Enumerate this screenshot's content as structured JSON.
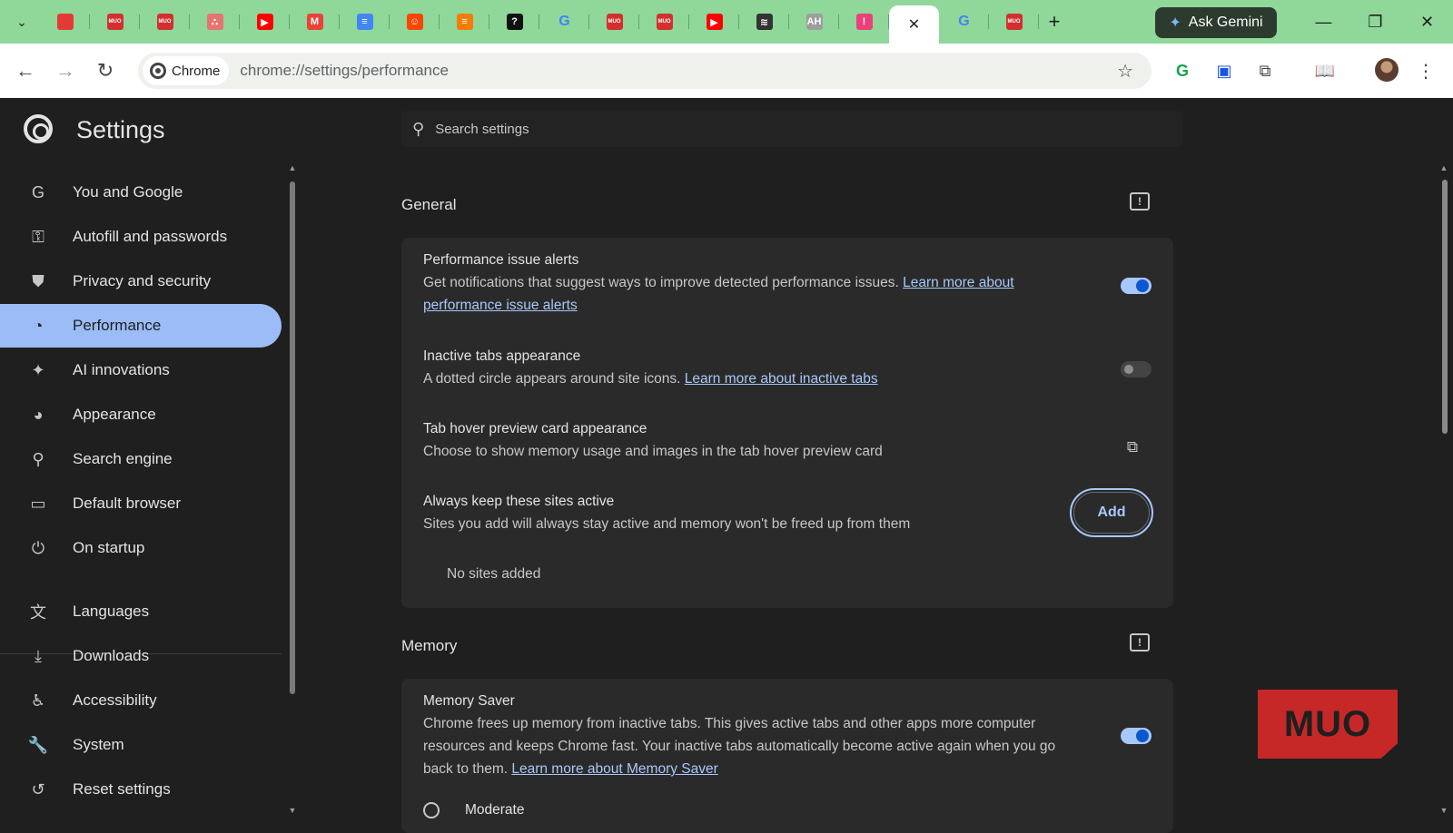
{
  "colors": {
    "tabstrip_bg": "#8fd89a",
    "page_bg": "#1f1f1f",
    "card_bg": "#2a2a2a",
    "active_nav_bg": "#9bbcf7",
    "link": "#a8c7fa",
    "toggle_on": "#0b57d0",
    "watermark": "#c62828"
  },
  "tabs": [
    {
      "icon": "red-circle-favicon",
      "color": "#e53935",
      "glyph": ""
    },
    {
      "icon": "red-badge-favicon",
      "color": "#d32f2f",
      "glyph": "MUO"
    },
    {
      "icon": "red-badge-favicon",
      "color": "#d32f2f",
      "glyph": "MUO"
    },
    {
      "icon": "dots-favicon",
      "color": "#e57373",
      "glyph": "∴"
    },
    {
      "icon": "youtube-favicon",
      "color": "#ff0000",
      "glyph": "▶"
    },
    {
      "icon": "gmail-favicon",
      "color": "#ea4335",
      "glyph": "M"
    },
    {
      "icon": "docs-favicon",
      "color": "#4285f4",
      "glyph": "≡"
    },
    {
      "icon": "reddit-favicon",
      "color": "#ff4500",
      "glyph": "☺"
    },
    {
      "icon": "orange-favicon",
      "color": "#f57c00",
      "glyph": "≡"
    },
    {
      "icon": "question-favicon",
      "color": "#111111",
      "glyph": "?"
    },
    {
      "icon": "google-favicon",
      "color": "#ffffff",
      "glyph": "G"
    },
    {
      "icon": "red-badge-favicon",
      "color": "#d32f2f",
      "glyph": "MUO"
    },
    {
      "icon": "red-badge-favicon",
      "color": "#d32f2f",
      "glyph": "MUO"
    },
    {
      "icon": "youtube-favicon",
      "color": "#ff0000",
      "glyph": "▶"
    },
    {
      "icon": "spiral-favicon",
      "color": "#333333",
      "glyph": "≋"
    },
    {
      "icon": "ah-favicon",
      "color": "#9e9e9e",
      "glyph": "AH"
    },
    {
      "icon": "pink-favicon",
      "color": "#ec407a",
      "glyph": "!"
    },
    {
      "icon": "close-icon",
      "color": "#ffffff",
      "glyph": "✕",
      "active": true
    },
    {
      "icon": "google-favicon",
      "color": "#ffffff",
      "glyph": "G"
    },
    {
      "icon": "red-badge-favicon",
      "color": "#d32f2f",
      "glyph": "MUO"
    }
  ],
  "ask_gemini_label": "Ask Gemini",
  "omnibox": {
    "chip_label": "Chrome",
    "url": "chrome://settings/performance"
  },
  "settings": {
    "title": "Settings",
    "search_placeholder": "Search settings"
  },
  "sidebar": {
    "items": [
      {
        "label": "You and Google",
        "icon": "google-g-icon",
        "glyph": "G"
      },
      {
        "label": "Autofill and passwords",
        "icon": "key-icon",
        "glyph": "⚿"
      },
      {
        "label": "Privacy and security",
        "icon": "shield-icon",
        "glyph": "⛊"
      },
      {
        "label": "Performance",
        "icon": "speedometer-icon",
        "glyph": "◔",
        "active": true
      },
      {
        "label": "AI innovations",
        "icon": "sparkle-icon",
        "glyph": "✦"
      },
      {
        "label": "Appearance",
        "icon": "palette-icon",
        "glyph": "◕"
      },
      {
        "label": "Search engine",
        "icon": "search-icon",
        "glyph": "⚲"
      },
      {
        "label": "Default browser",
        "icon": "browser-window-icon",
        "glyph": "▭"
      },
      {
        "label": "On startup",
        "icon": "power-icon",
        "glyph": "⏻"
      },
      {
        "label": "Languages",
        "icon": "translate-icon",
        "glyph": "文"
      },
      {
        "label": "Downloads",
        "icon": "download-icon",
        "glyph": "⤓"
      },
      {
        "label": "Accessibility",
        "icon": "accessibility-icon",
        "glyph": "♿"
      },
      {
        "label": "System",
        "icon": "wrench-icon",
        "glyph": "🔧"
      },
      {
        "label": "Reset settings",
        "icon": "reset-icon",
        "glyph": "↺"
      }
    ]
  },
  "general": {
    "title": "General",
    "performance_alerts": {
      "title": "Performance issue alerts",
      "desc": "Get notifications that suggest ways to improve detected performance issues. ",
      "link": "Learn more about performance issue alerts",
      "enabled": true
    },
    "inactive_tabs": {
      "title": "Inactive tabs appearance",
      "desc": "A dotted circle appears around site icons. ",
      "link": "Learn more about inactive tabs",
      "enabled": false
    },
    "tab_hover": {
      "title": "Tab hover preview card appearance",
      "desc": "Choose to show memory usage and images in the tab hover preview card"
    },
    "keep_active": {
      "title": "Always keep these sites active",
      "desc": "Sites you add will always stay active and memory won't be freed up from them",
      "add_label": "Add",
      "empty": "No sites added"
    }
  },
  "memory": {
    "title": "Memory",
    "memory_saver": {
      "title": "Memory Saver",
      "desc": "Chrome frees up memory from inactive tabs. This gives active tabs and other apps more computer resources and keeps Chrome fast. Your inactive tabs automatically become active again when you go back to them. ",
      "link": "Learn more about Memory Saver",
      "enabled": true
    },
    "option_moderate": "Moderate"
  },
  "watermark_text": "MUO"
}
